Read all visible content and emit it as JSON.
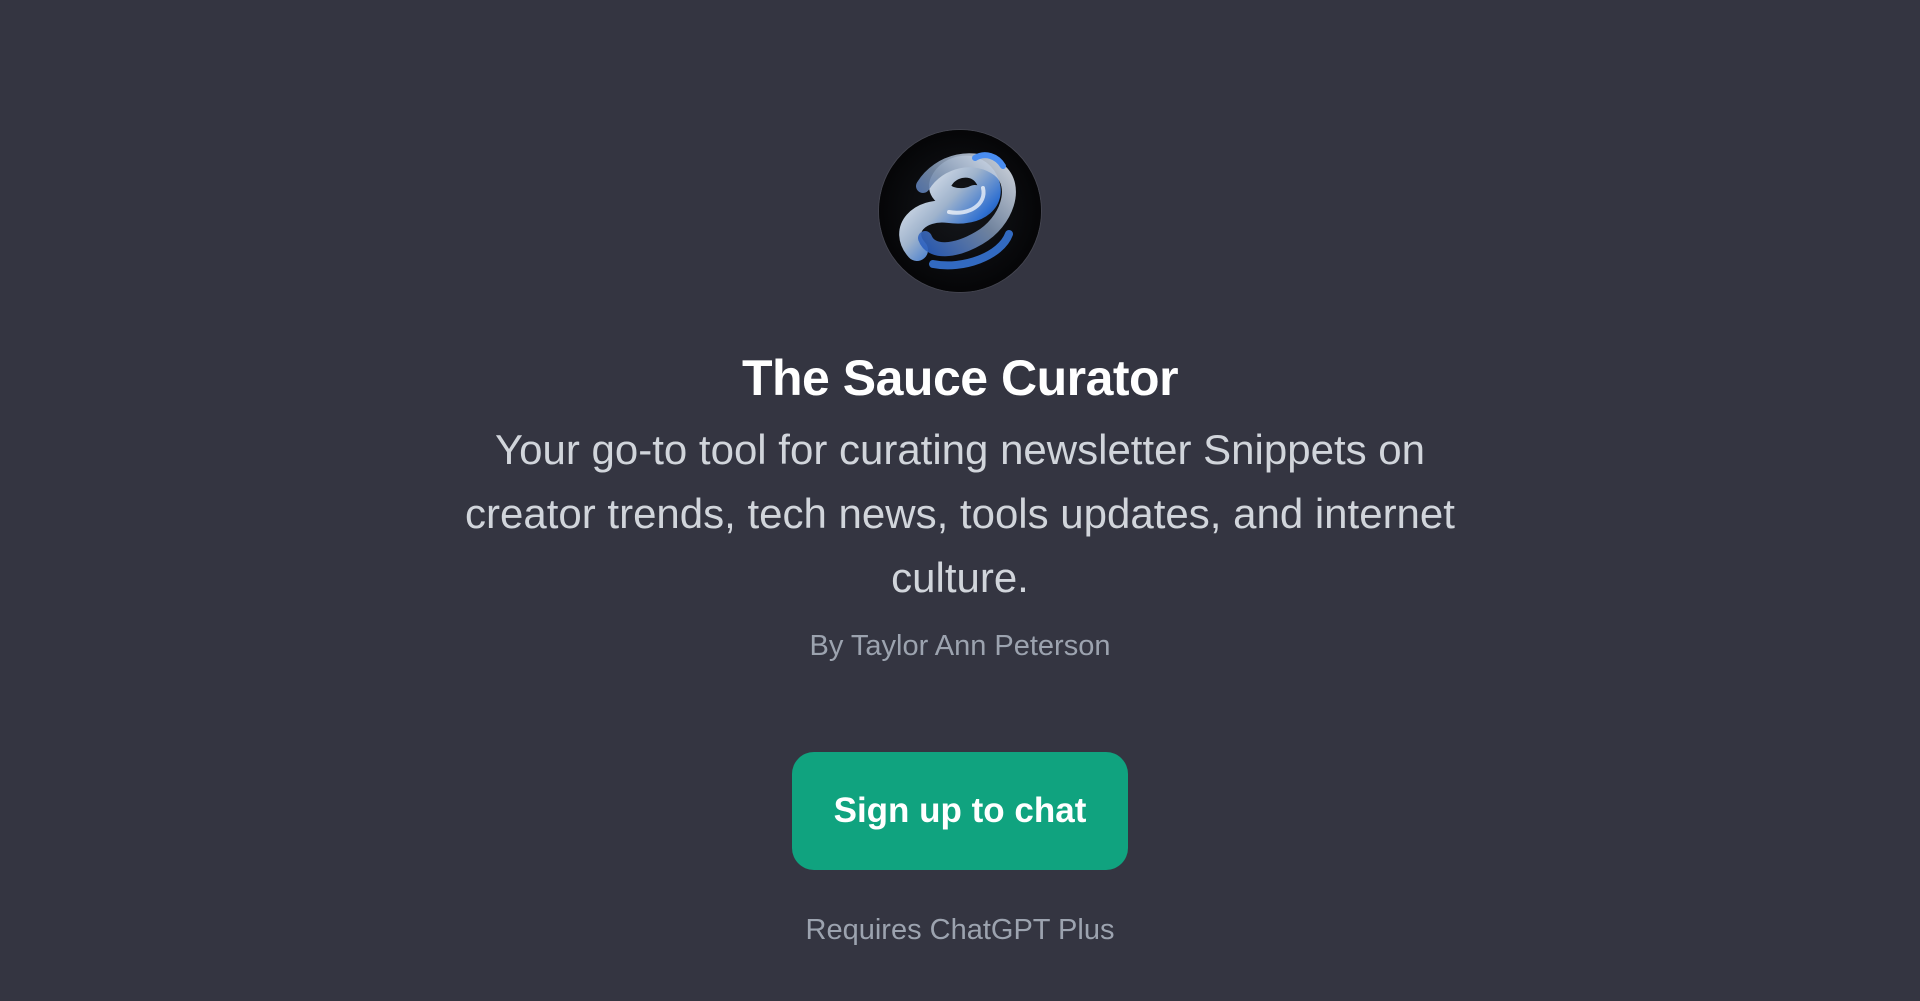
{
  "gpt": {
    "avatar_icon": "swirl-ribbon-logo-icon",
    "title": "The Sauce Curator",
    "description": "Your go-to tool for curating newsletter Snippets on creator trends, tech news, tools updates, and internet culture.",
    "author": "By Taylor Ann Peterson"
  },
  "cta": {
    "label": "Sign up to chat",
    "requirement": "Requires ChatGPT Plus"
  },
  "colors": {
    "background": "#343541",
    "accent": "#10a37f",
    "title": "#ffffff",
    "description": "#d1d5db",
    "muted": "#9ca3af"
  }
}
